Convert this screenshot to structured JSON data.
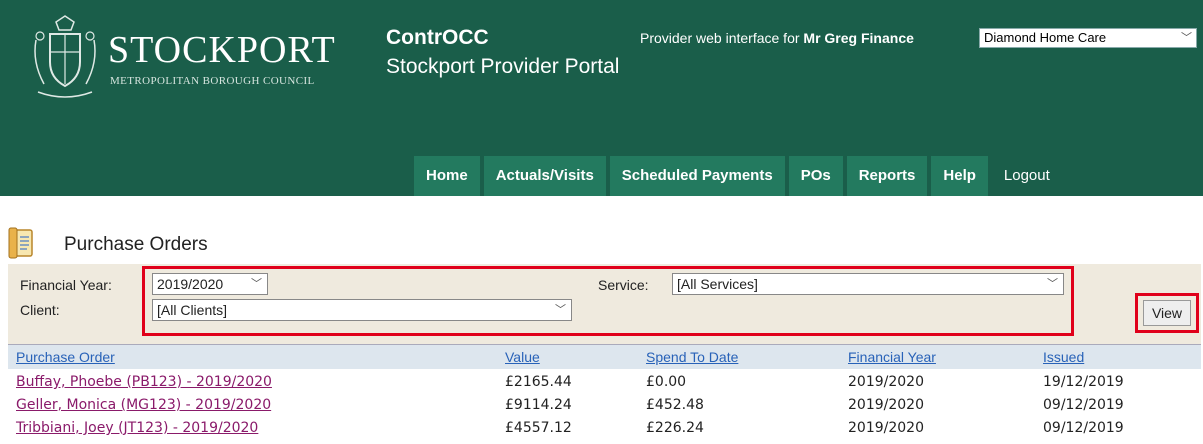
{
  "header": {
    "logo_title": "STOCKPORT",
    "logo_subtitle": "METROPOLITAN BOROUGH COUNCIL",
    "app_title": "ContrOCC",
    "app_subtitle": "Stockport Provider Portal",
    "provider_prefix": "Provider web interface for",
    "provider_user": "Mr Greg Finance",
    "provider_selected": "Diamond Home Care"
  },
  "nav": {
    "items": [
      {
        "label": "Home"
      },
      {
        "label": "Actuals/Visits"
      },
      {
        "label": "Scheduled Payments"
      },
      {
        "label": "POs"
      },
      {
        "label": "Reports"
      },
      {
        "label": "Help"
      },
      {
        "label": "Logout"
      }
    ]
  },
  "page": {
    "title": "Purchase Orders"
  },
  "filters": {
    "financial_year_label": "Financial Year:",
    "financial_year_value": "2019/2020",
    "client_label": "Client:",
    "client_value": "[All Clients]",
    "service_label": "Service:",
    "service_value": "[All Services]",
    "view_label": "View"
  },
  "table": {
    "columns": [
      "Purchase Order",
      "Value",
      "Spend To Date",
      "Financial Year",
      "Issued"
    ],
    "rows": [
      [
        "Buffay, Phoebe (PB123) - 2019/2020",
        "£2165.44",
        "£0.00",
        "2019/2020",
        "19/12/2019"
      ],
      [
        "Geller, Monica (MG123) - 2019/2020",
        "£9114.24",
        "£452.48",
        "2019/2020",
        "09/12/2019"
      ],
      [
        "Tribbiani, Joey (JT123) - 2019/2020",
        "£4557.12",
        "£226.24",
        "2019/2020",
        "09/12/2019"
      ]
    ]
  },
  "colors": {
    "header_bg": "#1a5e4a",
    "tab_bg": "#237a5f",
    "filter_bg": "#efeade",
    "highlight": "#e0001a",
    "link": "#8a1a6a"
  }
}
